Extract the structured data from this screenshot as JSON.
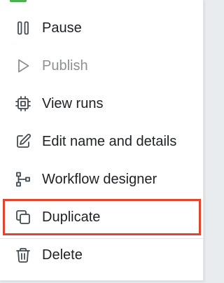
{
  "menu": {
    "items": [
      {
        "label": "Pause",
        "icon": "pause-icon",
        "disabled": false
      },
      {
        "label": "Publish",
        "icon": "play-icon",
        "disabled": true
      },
      {
        "label": "View runs",
        "icon": "chip-icon",
        "disabled": false
      },
      {
        "label": "Edit name and details",
        "icon": "pencil-edit-icon",
        "disabled": false
      },
      {
        "label": "Workflow designer",
        "icon": "workflow-tree-icon",
        "disabled": false
      },
      {
        "label": "Duplicate",
        "icon": "copy-icon",
        "disabled": false,
        "highlighted": true
      },
      {
        "label": "Delete",
        "icon": "trash-icon",
        "disabled": false
      }
    ]
  },
  "colors": {
    "highlight": "#e0452f",
    "text": "#1d2126",
    "disabled_text": "#8b9096",
    "accent": "#4caf50"
  }
}
